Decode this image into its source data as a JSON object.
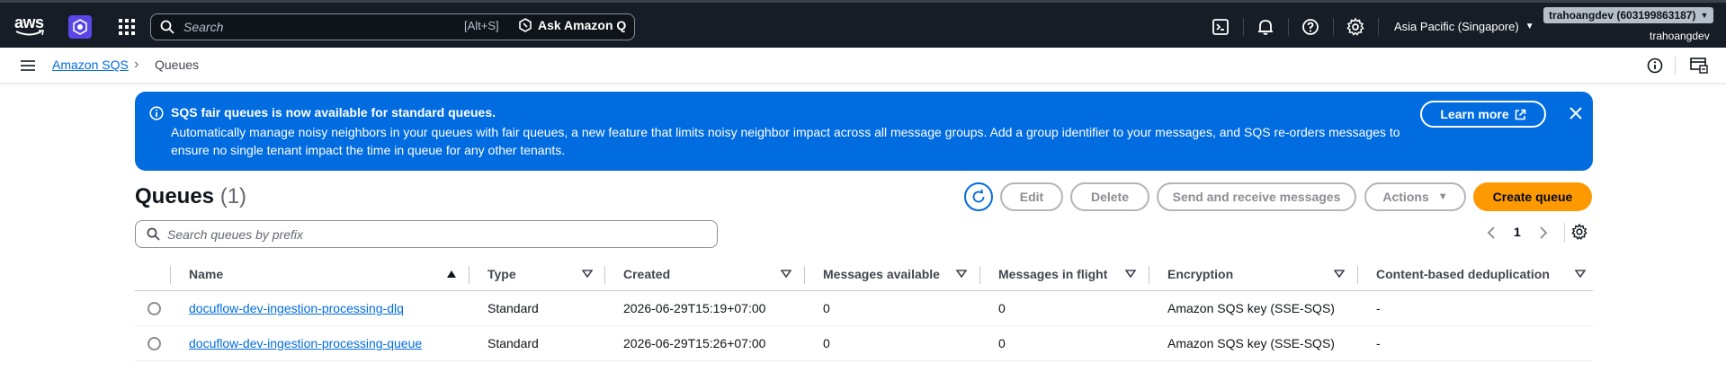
{
  "topnav": {
    "logo_text": "aws",
    "search_placeholder": "Search",
    "search_shortcut": "[Alt+S]",
    "ask_q_label": "Ask Amazon Q",
    "region": "Asia Pacific (Singapore)",
    "account_badge": "trahoangdev (603199863187)",
    "account_user": "trahoangdev",
    "icons": [
      "cloudshell-icon",
      "bell-icon",
      "help-icon",
      "settings-icon"
    ]
  },
  "breadcrumb": {
    "service": "Amazon SQS",
    "current": "Queues"
  },
  "flash": {
    "title": "SQS fair queues is now available for standard queues.",
    "body": "Automatically manage noisy neighbors in your queues with fair queues, a new feature that limits noisy neighbor impact across all message groups. Add a group identifier to your messages, and SQS re-orders messages to ensure no single tenant impact the time in queue for any other tenants.",
    "learn_more": "Learn more",
    "color": "#006ce0"
  },
  "header": {
    "title": "Queues",
    "count": "(1)",
    "buttons": {
      "edit": "Edit",
      "delete": "Delete",
      "send_receive": "Send and receive messages",
      "actions": "Actions",
      "create": "Create queue"
    },
    "primary_color": "#ff9900"
  },
  "filter": {
    "placeholder": "Search queues by prefix"
  },
  "pagination": {
    "current_page": "1"
  },
  "table": {
    "columns": [
      "Name",
      "Type",
      "Created",
      "Messages available",
      "Messages in flight",
      "Encryption",
      "Content-based deduplication"
    ],
    "rows": [
      {
        "name": "docuflow-dev-ingestion-processing-dlq",
        "type": "Standard",
        "created": "2026-06-29T15:19+07:00",
        "available": "0",
        "in_flight": "0",
        "encryption": "Amazon SQS key (SSE-SQS)",
        "dedup": "-"
      },
      {
        "name": "docuflow-dev-ingestion-processing-queue",
        "type": "Standard",
        "created": "2026-06-29T15:26+07:00",
        "available": "0",
        "in_flight": "0",
        "encryption": "Amazon SQS key (SSE-SQS)",
        "dedup": "-"
      }
    ]
  }
}
